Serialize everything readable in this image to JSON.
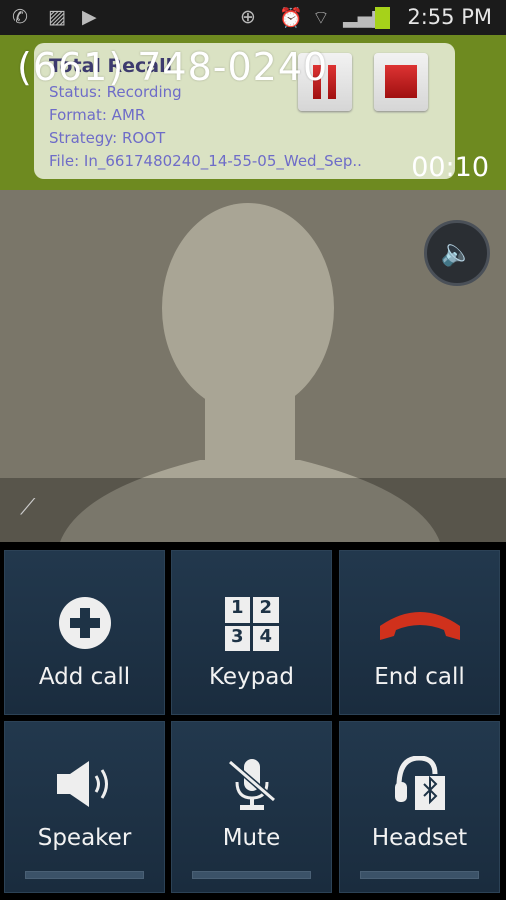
{
  "status_bar": {
    "time": "2:55 PM",
    "icons": [
      "phone-icon",
      "gallery-icon",
      "video-icon",
      "nfc-icon",
      "alarm-icon",
      "wifi-icon",
      "signal-icon",
      "battery-icon"
    ]
  },
  "call": {
    "number": "(661) 748-0240",
    "duration": "00:10"
  },
  "recorder": {
    "title": "Total Recall",
    "status": "Status: Recording",
    "format": "Format: AMR",
    "strategy": "Strategy: ROOT",
    "file": "File: In_6617480240_14-55-05_Wed_Sep..",
    "accent": "#c0181c"
  },
  "buttons": [
    {
      "label": "Add call",
      "icon": "add-call-icon"
    },
    {
      "label": "Keypad",
      "icon": "keypad-icon",
      "digits": [
        "1",
        "2",
        "3",
        "4"
      ]
    },
    {
      "label": "End call",
      "icon": "end-call-icon",
      "color": "#d0311c"
    },
    {
      "label": "Speaker",
      "icon": "speaker-icon"
    },
    {
      "label": "Mute",
      "icon": "mute-icon"
    },
    {
      "label": "Headset",
      "icon": "bluetooth-headset-icon"
    }
  ]
}
